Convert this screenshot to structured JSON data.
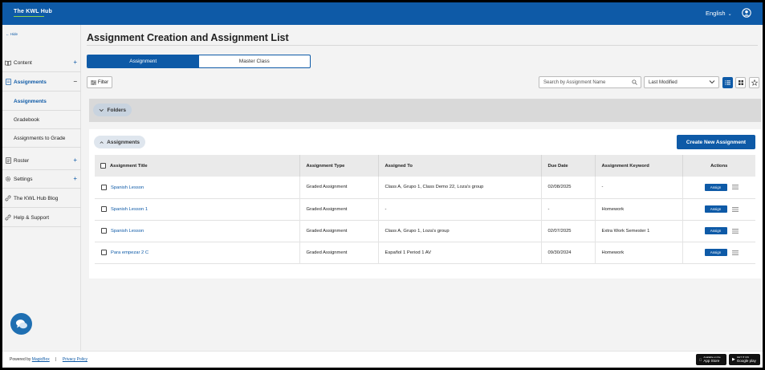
{
  "header": {
    "logo": "The KWL Hub",
    "language": "English"
  },
  "sidebar": {
    "hide_label": "← Hide",
    "items": [
      {
        "label": "Content",
        "icon": "book-icon",
        "expandable": true
      },
      {
        "label": "Assignments",
        "icon": "document-icon",
        "expanded": true
      },
      {
        "label": "Roster",
        "icon": "list-icon",
        "expandable": true
      },
      {
        "label": "Settings",
        "icon": "gear-icon",
        "expandable": true
      },
      {
        "label": "The KWL Hub Blog",
        "icon": "link-icon"
      },
      {
        "label": "Help & Support",
        "icon": "link-icon"
      }
    ],
    "sub_items": [
      {
        "label": "Assignments",
        "active": true
      },
      {
        "label": "Gradebook"
      },
      {
        "label": "Assignments to Grade"
      }
    ]
  },
  "main": {
    "title": "Assignment Creation and Assignment List",
    "tabs": [
      {
        "label": "Assignment",
        "active": true
      },
      {
        "label": "Master Class",
        "active": false
      }
    ],
    "filter_label": "Filter",
    "search_placeholder": "Search by Assignment Name",
    "sort_value": "Last Modified",
    "folders_label": "Folders",
    "assignments_label": "Assignments",
    "create_button": "Create New Assignment"
  },
  "table": {
    "columns": [
      "Assignment Title",
      "Assignment Type",
      "Assigned To",
      "Due Date",
      "Assignment Keyword",
      "Actions"
    ],
    "rows": [
      {
        "title": "Spanish Lesson",
        "type": "Graded Assignment",
        "assigned_to": "Class A, Grupo 1, Class Demo 22, Loza's group",
        "due": "02/08/2025",
        "keyword": "-"
      },
      {
        "title": "Spanish Lesson 1",
        "type": "Graded Assignment",
        "assigned_to": "-",
        "due": "-",
        "keyword": "Homework"
      },
      {
        "title": "Spanish Lesson",
        "type": "Graded Assignment",
        "assigned_to": "Class A, Grupo 1, Loza's group",
        "due": "02/07/2025",
        "keyword": "Extra Work Semester 1"
      },
      {
        "title": "Para empezar 2 C",
        "type": "Graded Assignment",
        "assigned_to": "Español 1 Period 1 AV",
        "due": "09/30/2024",
        "keyword": "Homework"
      }
    ],
    "assign_label": "Assign"
  },
  "footer": {
    "powered_by": "Powered by",
    "company": "MagicBox",
    "separator": "|",
    "privacy": "Privacy Policy",
    "app_store_small": "Available on the",
    "app_store": "App Store",
    "google_small": "GET IT ON",
    "google": "Google play"
  },
  "colors": {
    "brand_blue": "#0e5aa7",
    "accent_green": "#8fd14f"
  }
}
